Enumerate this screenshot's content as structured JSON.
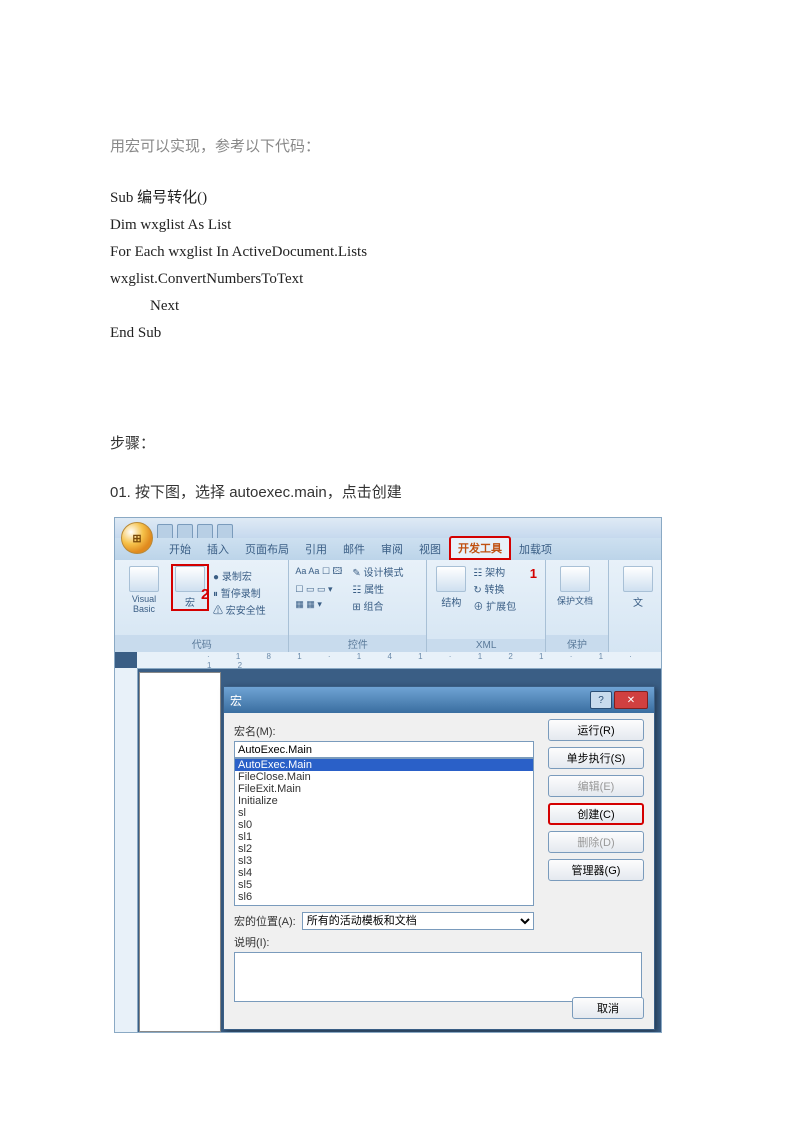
{
  "intro": "用宏可以实现，参考以下代码：",
  "code": {
    "l1": "Sub 编号转化()",
    "l2": "Dim wxglist As List",
    "l3": "For Each wxglist In ActiveDocument.Lists",
    "l4": "wxglist.ConvertNumbersToText",
    "l5": "Next",
    "l6": "End Sub"
  },
  "steps_heading": "步骤：",
  "step01": "01. 按下图，选择 autoexec.main，点击创建",
  "ribbon_tabs": {
    "home": "开始",
    "insert": "插入",
    "layout": "页面布局",
    "ref": "引用",
    "mail": "邮件",
    "review": "审阅",
    "view": "视图",
    "dev": "开发工具",
    "addin": "加载项"
  },
  "ribbon": {
    "vb": "Visual Basic",
    "macro": "宏",
    "record": "录制宏",
    "pause": "暂停录制",
    "security": "宏安全性",
    "group_code": "代码",
    "design": "设计模式",
    "prop": "属性",
    "group_ctrl": "控件",
    "combine": "组合",
    "struct": "结构",
    "schema": "架构",
    "transform": "转换",
    "expand": "扩展包",
    "group_xml": "XML",
    "protect": "保护文档",
    "group_protect": "保护",
    "tmpl": "文"
  },
  "badge1": "1",
  "badge2": "2",
  "dialog": {
    "title": "宏",
    "name_label": "宏名(M):",
    "name_value": "AutoExec.Main",
    "list": [
      "AutoExec.Main",
      "FileClose.Main",
      "FileExit.Main",
      "Initialize",
      "sl",
      "sl0",
      "sl1",
      "sl2",
      "sl3",
      "sl4",
      "sl5",
      "sl6"
    ],
    "loc_label": "宏的位置(A):",
    "loc_value": "所有的活动模板和文档",
    "desc_label": "说明(I):",
    "btn_run": "运行(R)",
    "btn_step": "单步执行(S)",
    "btn_edit": "编辑(E)",
    "btn_create": "创建(C)",
    "btn_delete": "删除(D)",
    "btn_org": "管理器(G)",
    "btn_cancel": "取消",
    "help": "?",
    "close": "✕"
  }
}
